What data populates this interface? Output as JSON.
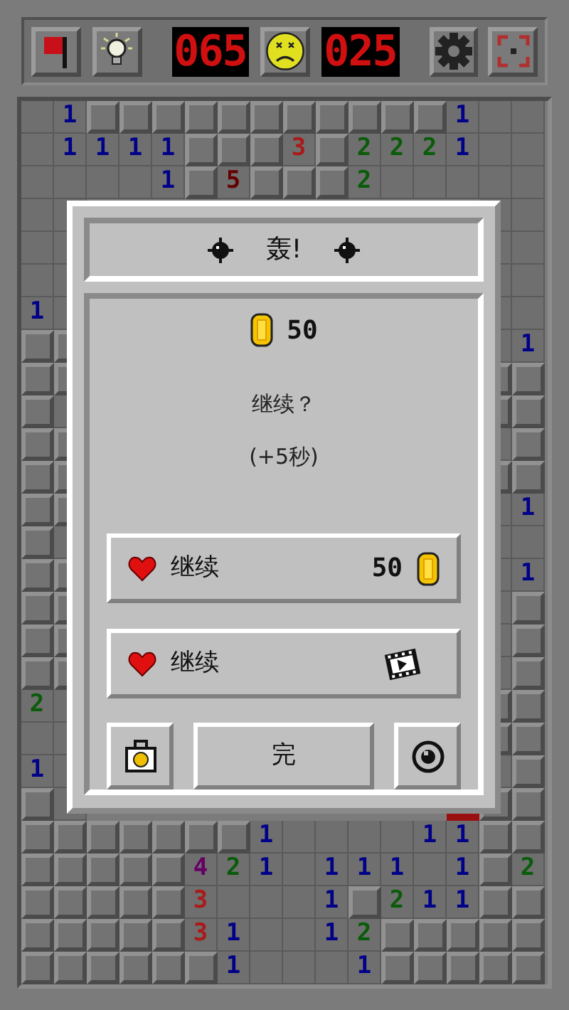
{
  "toolbar": {
    "mines": "065",
    "timer": "025"
  },
  "board": {
    "rows": [
      {
        "cells": [
          {
            "kind": "open"
          },
          {
            "kind": "number",
            "text": "1",
            "color": "#000088"
          },
          {
            "kind": "covered"
          },
          {
            "kind": "covered"
          },
          {
            "kind": "covered"
          },
          {
            "kind": "covered"
          },
          {
            "kind": "covered"
          },
          {
            "kind": "covered"
          },
          {
            "kind": "covered"
          },
          {
            "kind": "covered"
          },
          {
            "kind": "covered"
          },
          {
            "kind": "covered"
          },
          {
            "kind": "covered"
          },
          {
            "kind": "number",
            "text": "1",
            "color": "#000088"
          },
          {
            "kind": "open"
          },
          {
            "kind": "open"
          }
        ]
      },
      {
        "cells": [
          {
            "kind": "open"
          },
          {
            "kind": "number",
            "text": "1",
            "color": "#000088"
          },
          {
            "kind": "number",
            "text": "1",
            "color": "#000088"
          },
          {
            "kind": "number",
            "text": "1",
            "color": "#000088"
          },
          {
            "kind": "number",
            "text": "1",
            "color": "#000088"
          },
          {
            "kind": "covered"
          },
          {
            "kind": "covered"
          },
          {
            "kind": "covered"
          },
          {
            "kind": "number",
            "text": "3",
            "color": "#aa1a1a"
          },
          {
            "kind": "covered"
          },
          {
            "kind": "number",
            "text": "2",
            "color": "#0a5c0a"
          },
          {
            "kind": "number",
            "text": "2",
            "color": "#0a5c0a"
          },
          {
            "kind": "number",
            "text": "2",
            "color": "#0a5c0a"
          },
          {
            "kind": "number",
            "text": "1",
            "color": "#000088"
          },
          {
            "kind": "open"
          },
          {
            "kind": "open"
          }
        ]
      },
      {
        "cells": [
          {
            "kind": "open"
          },
          {
            "kind": "open"
          },
          {
            "kind": "open"
          },
          {
            "kind": "open"
          },
          {
            "kind": "number",
            "text": "1",
            "color": "#000088"
          },
          {
            "kind": "covered"
          },
          {
            "kind": "number",
            "text": "5",
            "color": "#660000"
          },
          {
            "kind": "covered"
          },
          {
            "kind": "covered"
          },
          {
            "kind": "covered"
          },
          {
            "kind": "number",
            "text": "2",
            "color": "#0a5c0a"
          },
          {
            "kind": "open"
          },
          {
            "kind": "open"
          },
          {
            "kind": "open"
          },
          {
            "kind": "open"
          },
          {
            "kind": "open"
          }
        ]
      },
      {
        "cells": [
          {
            "kind": "open"
          },
          {
            "kind": "open"
          },
          null,
          null,
          null,
          null,
          null,
          null,
          null,
          null,
          null,
          null,
          null,
          null,
          {
            "kind": "open"
          },
          {
            "kind": "open"
          }
        ]
      },
      {
        "cells": [
          {
            "kind": "open"
          },
          {
            "kind": "open"
          },
          null,
          null,
          null,
          null,
          null,
          null,
          null,
          null,
          null,
          null,
          null,
          null,
          {
            "kind": "open"
          },
          {
            "kind": "open"
          }
        ]
      },
      {
        "cells": [
          {
            "kind": "open"
          },
          {
            "kind": "open"
          },
          null,
          null,
          null,
          null,
          null,
          null,
          null,
          null,
          null,
          null,
          null,
          null,
          {
            "kind": "open"
          },
          {
            "kind": "open"
          }
        ]
      },
      {
        "cells": [
          {
            "kind": "number",
            "text": "1",
            "color": "#000088"
          },
          {
            "kind": "open"
          },
          null,
          null,
          null,
          null,
          null,
          null,
          null,
          null,
          null,
          null,
          null,
          null,
          {
            "kind": "open"
          },
          {
            "kind": "open"
          }
        ]
      },
      {
        "cells": [
          {
            "kind": "covered"
          },
          {
            "kind": "covered"
          },
          null,
          null,
          null,
          null,
          null,
          null,
          null,
          null,
          null,
          null,
          null,
          null,
          {
            "kind": "open"
          },
          {
            "kind": "number",
            "text": "1",
            "color": "#000088"
          }
        ]
      },
      {
        "cells": [
          {
            "kind": "covered"
          },
          {
            "kind": "covered"
          },
          null,
          null,
          null,
          null,
          null,
          null,
          null,
          null,
          null,
          null,
          null,
          null,
          {
            "kind": "covered"
          },
          {
            "kind": "covered"
          }
        ]
      },
      {
        "cells": [
          {
            "kind": "covered"
          },
          {
            "kind": "open"
          },
          null,
          null,
          null,
          null,
          null,
          null,
          null,
          null,
          null,
          null,
          null,
          null,
          {
            "kind": "covered"
          },
          {
            "kind": "covered"
          }
        ]
      },
      {
        "cells": [
          {
            "kind": "covered"
          },
          {
            "kind": "covered"
          },
          null,
          null,
          null,
          null,
          null,
          null,
          null,
          null,
          null,
          null,
          null,
          null,
          {
            "kind": "open"
          },
          {
            "kind": "covered"
          }
        ]
      },
      {
        "cells": [
          {
            "kind": "covered"
          },
          {
            "kind": "covered"
          },
          null,
          null,
          null,
          null,
          null,
          null,
          null,
          null,
          null,
          null,
          null,
          null,
          {
            "kind": "covered"
          },
          {
            "kind": "covered"
          }
        ]
      },
      {
        "cells": [
          {
            "kind": "covered"
          },
          {
            "kind": "covered"
          },
          null,
          null,
          null,
          null,
          null,
          null,
          null,
          null,
          null,
          null,
          null,
          null,
          {
            "kind": "open"
          },
          {
            "kind": "number",
            "text": "1",
            "color": "#000088"
          }
        ]
      },
      {
        "cells": [
          {
            "kind": "covered"
          },
          {
            "kind": "open"
          },
          null,
          null,
          null,
          null,
          null,
          null,
          null,
          null,
          null,
          null,
          null,
          null,
          {
            "kind": "open"
          },
          {
            "kind": "open"
          }
        ]
      },
      {
        "cells": [
          {
            "kind": "covered"
          },
          {
            "kind": "covered"
          },
          null,
          null,
          null,
          null,
          null,
          null,
          null,
          null,
          null,
          null,
          null,
          null,
          {
            "kind": "open"
          },
          {
            "kind": "number",
            "text": "1",
            "color": "#000088"
          }
        ]
      },
      {
        "cells": [
          {
            "kind": "covered"
          },
          {
            "kind": "covered"
          },
          null,
          null,
          null,
          null,
          null,
          null,
          null,
          null,
          null,
          null,
          null,
          null,
          {
            "kind": "open"
          },
          {
            "kind": "covered"
          }
        ]
      },
      {
        "cells": [
          {
            "kind": "covered"
          },
          {
            "kind": "covered"
          },
          null,
          null,
          null,
          null,
          null,
          null,
          null,
          null,
          null,
          null,
          null,
          null,
          {
            "kind": "open"
          },
          {
            "kind": "covered"
          }
        ]
      },
      {
        "cells": [
          {
            "kind": "covered"
          },
          {
            "kind": "covered"
          },
          null,
          null,
          null,
          null,
          null,
          null,
          null,
          null,
          null,
          null,
          null,
          null,
          {
            "kind": "open"
          },
          {
            "kind": "covered"
          }
        ]
      },
      {
        "cells": [
          {
            "kind": "number",
            "text": "2",
            "color": "#0a5c0a"
          },
          {
            "kind": "open"
          },
          null,
          null,
          null,
          null,
          null,
          null,
          null,
          null,
          null,
          null,
          null,
          null,
          {
            "kind": "covered"
          },
          {
            "kind": "covered"
          }
        ]
      },
      {
        "cells": [
          {
            "kind": "open"
          },
          {
            "kind": "open"
          },
          null,
          null,
          null,
          null,
          null,
          null,
          null,
          null,
          null,
          null,
          null,
          null,
          {
            "kind": "covered"
          },
          {
            "kind": "covered"
          }
        ]
      },
      {
        "cells": [
          {
            "kind": "number",
            "text": "1",
            "color": "#000088"
          },
          {
            "kind": "open"
          },
          null,
          null,
          null,
          null,
          null,
          null,
          null,
          null,
          null,
          null,
          null,
          null,
          {
            "kind": "open"
          },
          {
            "kind": "covered"
          }
        ]
      },
      {
        "cells": [
          {
            "kind": "covered"
          },
          {
            "kind": "open"
          },
          null,
          null,
          null,
          null,
          null,
          null,
          null,
          null,
          null,
          null,
          null,
          {
            "kind": "exploded"
          },
          {
            "kind": "covered"
          },
          {
            "kind": "covered"
          }
        ]
      },
      {
        "cells": [
          {
            "kind": "covered"
          },
          {
            "kind": "covered"
          },
          {
            "kind": "covered"
          },
          {
            "kind": "covered"
          },
          {
            "kind": "covered"
          },
          {
            "kind": "covered"
          },
          {
            "kind": "covered"
          },
          {
            "kind": "number",
            "text": "1",
            "color": "#000088"
          },
          {
            "kind": "open"
          },
          {
            "kind": "open"
          },
          {
            "kind": "open"
          },
          {
            "kind": "open"
          },
          {
            "kind": "number",
            "text": "1",
            "color": "#000088"
          },
          {
            "kind": "number",
            "text": "1",
            "color": "#000088"
          },
          {
            "kind": "covered"
          },
          {
            "kind": "covered"
          }
        ]
      },
      {
        "cells": [
          {
            "kind": "covered"
          },
          {
            "kind": "covered"
          },
          {
            "kind": "covered"
          },
          {
            "kind": "covered"
          },
          {
            "kind": "covered"
          },
          {
            "kind": "number",
            "text": "4",
            "color": "#660066"
          },
          {
            "kind": "number",
            "text": "2",
            "color": "#0a5c0a"
          },
          {
            "kind": "number",
            "text": "1",
            "color": "#000088"
          },
          {
            "kind": "open"
          },
          {
            "kind": "number",
            "text": "1",
            "color": "#000088"
          },
          {
            "kind": "number",
            "text": "1",
            "color": "#000088"
          },
          {
            "kind": "number",
            "text": "1",
            "color": "#000088"
          },
          {
            "kind": "open"
          },
          {
            "kind": "number",
            "text": "1",
            "color": "#000088"
          },
          {
            "kind": "covered"
          },
          {
            "kind": "number",
            "text": "2",
            "color": "#0a5c0a"
          }
        ]
      },
      {
        "cells": [
          {
            "kind": "covered"
          },
          {
            "kind": "covered"
          },
          {
            "kind": "covered"
          },
          {
            "kind": "covered"
          },
          {
            "kind": "covered"
          },
          {
            "kind": "number",
            "text": "3",
            "color": "#aa1a1a"
          },
          {
            "kind": "open"
          },
          {
            "kind": "open"
          },
          {
            "kind": "open"
          },
          {
            "kind": "number",
            "text": "1",
            "color": "#000088"
          },
          {
            "kind": "covered"
          },
          {
            "kind": "number",
            "text": "2",
            "color": "#0a5c0a"
          },
          {
            "kind": "number",
            "text": "1",
            "color": "#000088"
          },
          {
            "kind": "number",
            "text": "1",
            "color": "#000088"
          },
          {
            "kind": "covered"
          },
          {
            "kind": "covered"
          }
        ]
      },
      {
        "cells": [
          {
            "kind": "covered"
          },
          {
            "kind": "covered"
          },
          {
            "kind": "covered"
          },
          {
            "kind": "covered"
          },
          {
            "kind": "covered"
          },
          {
            "kind": "number",
            "text": "3",
            "color": "#aa1a1a"
          },
          {
            "kind": "number",
            "text": "1",
            "color": "#000088"
          },
          {
            "kind": "open"
          },
          {
            "kind": "open"
          },
          {
            "kind": "number",
            "text": "1",
            "color": "#000088"
          },
          {
            "kind": "number",
            "text": "2",
            "color": "#0a5c0a"
          },
          {
            "kind": "covered"
          },
          {
            "kind": "covered"
          },
          {
            "kind": "covered"
          },
          {
            "kind": "covered"
          },
          {
            "kind": "covered"
          }
        ]
      },
      {
        "cells": [
          {
            "kind": "covered"
          },
          {
            "kind": "covered"
          },
          {
            "kind": "covered"
          },
          {
            "kind": "covered"
          },
          {
            "kind": "covered"
          },
          {
            "kind": "covered"
          },
          {
            "kind": "number",
            "text": "1",
            "color": "#000088"
          },
          {
            "kind": "open"
          },
          {
            "kind": "open"
          },
          {
            "kind": "open"
          },
          {
            "kind": "number",
            "text": "1",
            "color": "#000088"
          },
          {
            "kind": "covered"
          },
          {
            "kind": "covered"
          },
          {
            "kind": "covered"
          },
          {
            "kind": "covered"
          },
          {
            "kind": "covered"
          }
        ]
      }
    ]
  },
  "dialog": {
    "title": "轰!",
    "coins": "50",
    "question": "继续？",
    "bonus": "(+5秒)",
    "buttons": [
      {
        "kind": "coin",
        "label": "继续",
        "price": "50"
      },
      {
        "kind": "video",
        "label": "继续"
      }
    ],
    "finish": "完"
  }
}
